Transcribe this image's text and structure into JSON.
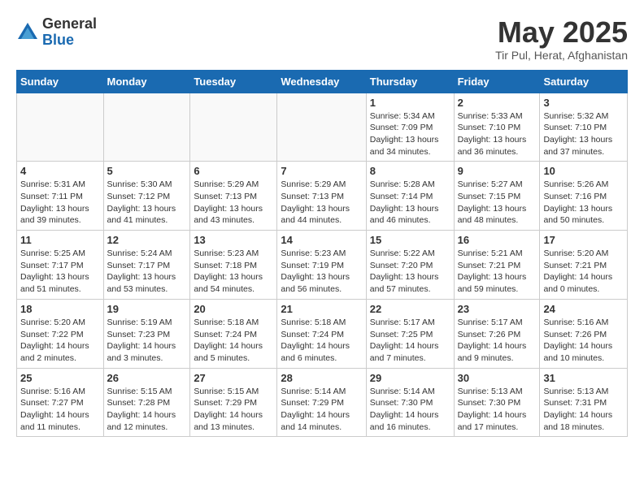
{
  "header": {
    "logo_general": "General",
    "logo_blue": "Blue",
    "month_title": "May 2025",
    "location": "Tir Pul, Herat, Afghanistan"
  },
  "days_of_week": [
    "Sunday",
    "Monday",
    "Tuesday",
    "Wednesday",
    "Thursday",
    "Friday",
    "Saturday"
  ],
  "weeks": [
    [
      {
        "day": "",
        "info": ""
      },
      {
        "day": "",
        "info": ""
      },
      {
        "day": "",
        "info": ""
      },
      {
        "day": "",
        "info": ""
      },
      {
        "day": "1",
        "info": "Sunrise: 5:34 AM\nSunset: 7:09 PM\nDaylight: 13 hours\nand 34 minutes."
      },
      {
        "day": "2",
        "info": "Sunrise: 5:33 AM\nSunset: 7:10 PM\nDaylight: 13 hours\nand 36 minutes."
      },
      {
        "day": "3",
        "info": "Sunrise: 5:32 AM\nSunset: 7:10 PM\nDaylight: 13 hours\nand 37 minutes."
      }
    ],
    [
      {
        "day": "4",
        "info": "Sunrise: 5:31 AM\nSunset: 7:11 PM\nDaylight: 13 hours\nand 39 minutes."
      },
      {
        "day": "5",
        "info": "Sunrise: 5:30 AM\nSunset: 7:12 PM\nDaylight: 13 hours\nand 41 minutes."
      },
      {
        "day": "6",
        "info": "Sunrise: 5:29 AM\nSunset: 7:13 PM\nDaylight: 13 hours\nand 43 minutes."
      },
      {
        "day": "7",
        "info": "Sunrise: 5:29 AM\nSunset: 7:13 PM\nDaylight: 13 hours\nand 44 minutes."
      },
      {
        "day": "8",
        "info": "Sunrise: 5:28 AM\nSunset: 7:14 PM\nDaylight: 13 hours\nand 46 minutes."
      },
      {
        "day": "9",
        "info": "Sunrise: 5:27 AM\nSunset: 7:15 PM\nDaylight: 13 hours\nand 48 minutes."
      },
      {
        "day": "10",
        "info": "Sunrise: 5:26 AM\nSunset: 7:16 PM\nDaylight: 13 hours\nand 50 minutes."
      }
    ],
    [
      {
        "day": "11",
        "info": "Sunrise: 5:25 AM\nSunset: 7:17 PM\nDaylight: 13 hours\nand 51 minutes."
      },
      {
        "day": "12",
        "info": "Sunrise: 5:24 AM\nSunset: 7:17 PM\nDaylight: 13 hours\nand 53 minutes."
      },
      {
        "day": "13",
        "info": "Sunrise: 5:23 AM\nSunset: 7:18 PM\nDaylight: 13 hours\nand 54 minutes."
      },
      {
        "day": "14",
        "info": "Sunrise: 5:23 AM\nSunset: 7:19 PM\nDaylight: 13 hours\nand 56 minutes."
      },
      {
        "day": "15",
        "info": "Sunrise: 5:22 AM\nSunset: 7:20 PM\nDaylight: 13 hours\nand 57 minutes."
      },
      {
        "day": "16",
        "info": "Sunrise: 5:21 AM\nSunset: 7:21 PM\nDaylight: 13 hours\nand 59 minutes."
      },
      {
        "day": "17",
        "info": "Sunrise: 5:20 AM\nSunset: 7:21 PM\nDaylight: 14 hours\nand 0 minutes."
      }
    ],
    [
      {
        "day": "18",
        "info": "Sunrise: 5:20 AM\nSunset: 7:22 PM\nDaylight: 14 hours\nand 2 minutes."
      },
      {
        "day": "19",
        "info": "Sunrise: 5:19 AM\nSunset: 7:23 PM\nDaylight: 14 hours\nand 3 minutes."
      },
      {
        "day": "20",
        "info": "Sunrise: 5:18 AM\nSunset: 7:24 PM\nDaylight: 14 hours\nand 5 minutes."
      },
      {
        "day": "21",
        "info": "Sunrise: 5:18 AM\nSunset: 7:24 PM\nDaylight: 14 hours\nand 6 minutes."
      },
      {
        "day": "22",
        "info": "Sunrise: 5:17 AM\nSunset: 7:25 PM\nDaylight: 14 hours\nand 7 minutes."
      },
      {
        "day": "23",
        "info": "Sunrise: 5:17 AM\nSunset: 7:26 PM\nDaylight: 14 hours\nand 9 minutes."
      },
      {
        "day": "24",
        "info": "Sunrise: 5:16 AM\nSunset: 7:26 PM\nDaylight: 14 hours\nand 10 minutes."
      }
    ],
    [
      {
        "day": "25",
        "info": "Sunrise: 5:16 AM\nSunset: 7:27 PM\nDaylight: 14 hours\nand 11 minutes."
      },
      {
        "day": "26",
        "info": "Sunrise: 5:15 AM\nSunset: 7:28 PM\nDaylight: 14 hours\nand 12 minutes."
      },
      {
        "day": "27",
        "info": "Sunrise: 5:15 AM\nSunset: 7:29 PM\nDaylight: 14 hours\nand 13 minutes."
      },
      {
        "day": "28",
        "info": "Sunrise: 5:14 AM\nSunset: 7:29 PM\nDaylight: 14 hours\nand 14 minutes."
      },
      {
        "day": "29",
        "info": "Sunrise: 5:14 AM\nSunset: 7:30 PM\nDaylight: 14 hours\nand 16 minutes."
      },
      {
        "day": "30",
        "info": "Sunrise: 5:13 AM\nSunset: 7:30 PM\nDaylight: 14 hours\nand 17 minutes."
      },
      {
        "day": "31",
        "info": "Sunrise: 5:13 AM\nSunset: 7:31 PM\nDaylight: 14 hours\nand 18 minutes."
      }
    ]
  ]
}
